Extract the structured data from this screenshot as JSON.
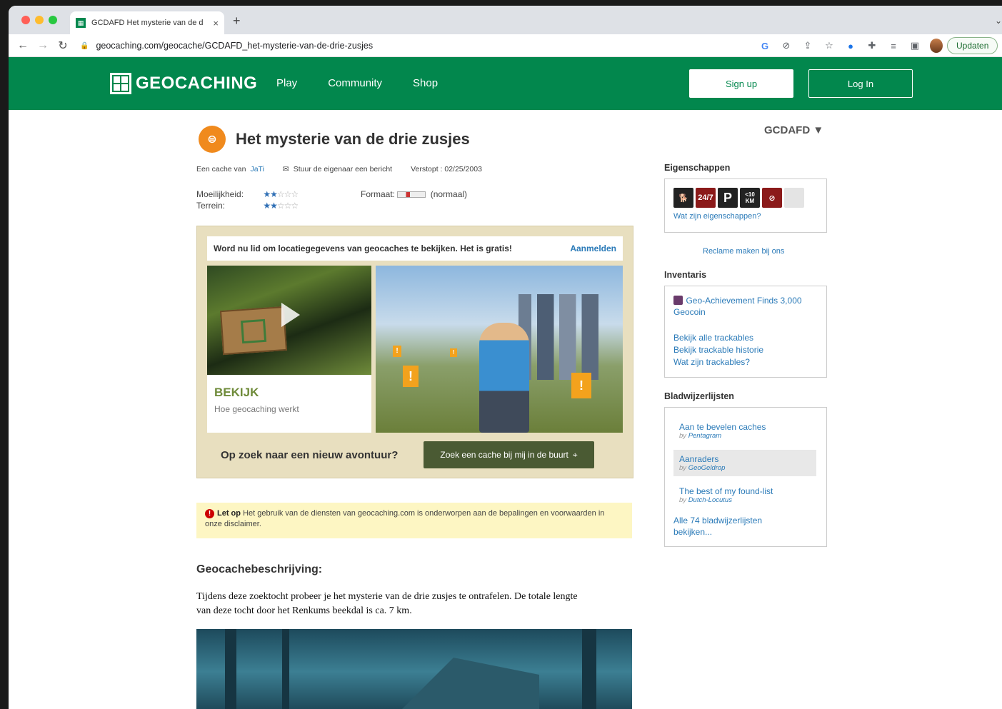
{
  "browser": {
    "tab_title": "GCDAFD Het mysterie van de d",
    "tab_close": "×",
    "new_tab": "+",
    "url": "geocaching.com/geocache/GCDAFD_het-mysterie-van-de-drie-zusjes",
    "update_label": "Updaten"
  },
  "header": {
    "logo_text": "GEOCACHING",
    "nav": [
      "Play",
      "Community",
      "Shop"
    ],
    "signup": "Sign up",
    "login": "Log In"
  },
  "cache": {
    "title": "Het mysterie van de drie zusjes",
    "code": "GCDAFD ▼",
    "owner_prefix": "Een cache van",
    "owner": "JaTi",
    "message_owner": "Stuur de eigenaar een bericht",
    "hidden": "Verstopt : 02/25/2003",
    "difficulty_label": "Moeilijkheid:",
    "terrain_label": "Terrein:",
    "difficulty": 2,
    "terrain": 2,
    "size_label": "Formaat:",
    "size_value": "(normaal)"
  },
  "promo": {
    "message": "Word nu lid om locatiegegevens van geocaches te bekijken. Het is gratis!",
    "join": "Aanmelden",
    "watch_title": "BEKIJK",
    "watch_sub": "Hoe geocaching werkt",
    "question": "Op zoek naar een nieuw avontuur?",
    "button": "Zoek een cache bij mij in de buurt"
  },
  "notice": {
    "bold": "Let op",
    "text": "Het gebruik van de diensten van geocaching.com is onderworpen aan de bepalingen en voorwaarden in onze disclaimer."
  },
  "description": {
    "heading": "Geocachebeschrijving:",
    "text": "Tijdens deze zoektocht probeer je het mysterie van de drie zusjes te ontrafelen. De totale lengte van deze tocht door het Renkums beekdal is ca. 7 km."
  },
  "sidebar": {
    "attributes_heading": "Eigenschappen",
    "attributes": [
      "dog-icon",
      "24-7-icon",
      "parking-icon",
      "under-10km-icon",
      "no-campfire-icon",
      "blank-icon"
    ],
    "attributes_link": "Wat zijn eigenschappen?",
    "ad_link": "Reclame maken bij ons",
    "inventory_heading": "Inventaris",
    "inventory_item": "Geo-Achievement Finds 3,000 Geocoin",
    "inventory_links": [
      "Bekijk alle trackables",
      "Bekijk trackable historie",
      "Wat zijn trackables?"
    ],
    "bookmarks_heading": "Bladwijzerlijsten",
    "bookmarks": [
      {
        "name": "Aan te bevelen caches",
        "by": "by",
        "owner": "Pentagram"
      },
      {
        "name": "Aanraders",
        "by": "by",
        "owner": "GeoGeldrop"
      },
      {
        "name": "The best of my found-list",
        "by": "by",
        "owner": "Dutch-Locutus"
      }
    ],
    "bookmarks_all": "Alle 74 bladwijzerlijsten bekijken..."
  },
  "colors": {
    "brand_green": "#02874d",
    "link_blue": "#2a7ab8",
    "promo_bg": "#e8dfbf"
  }
}
